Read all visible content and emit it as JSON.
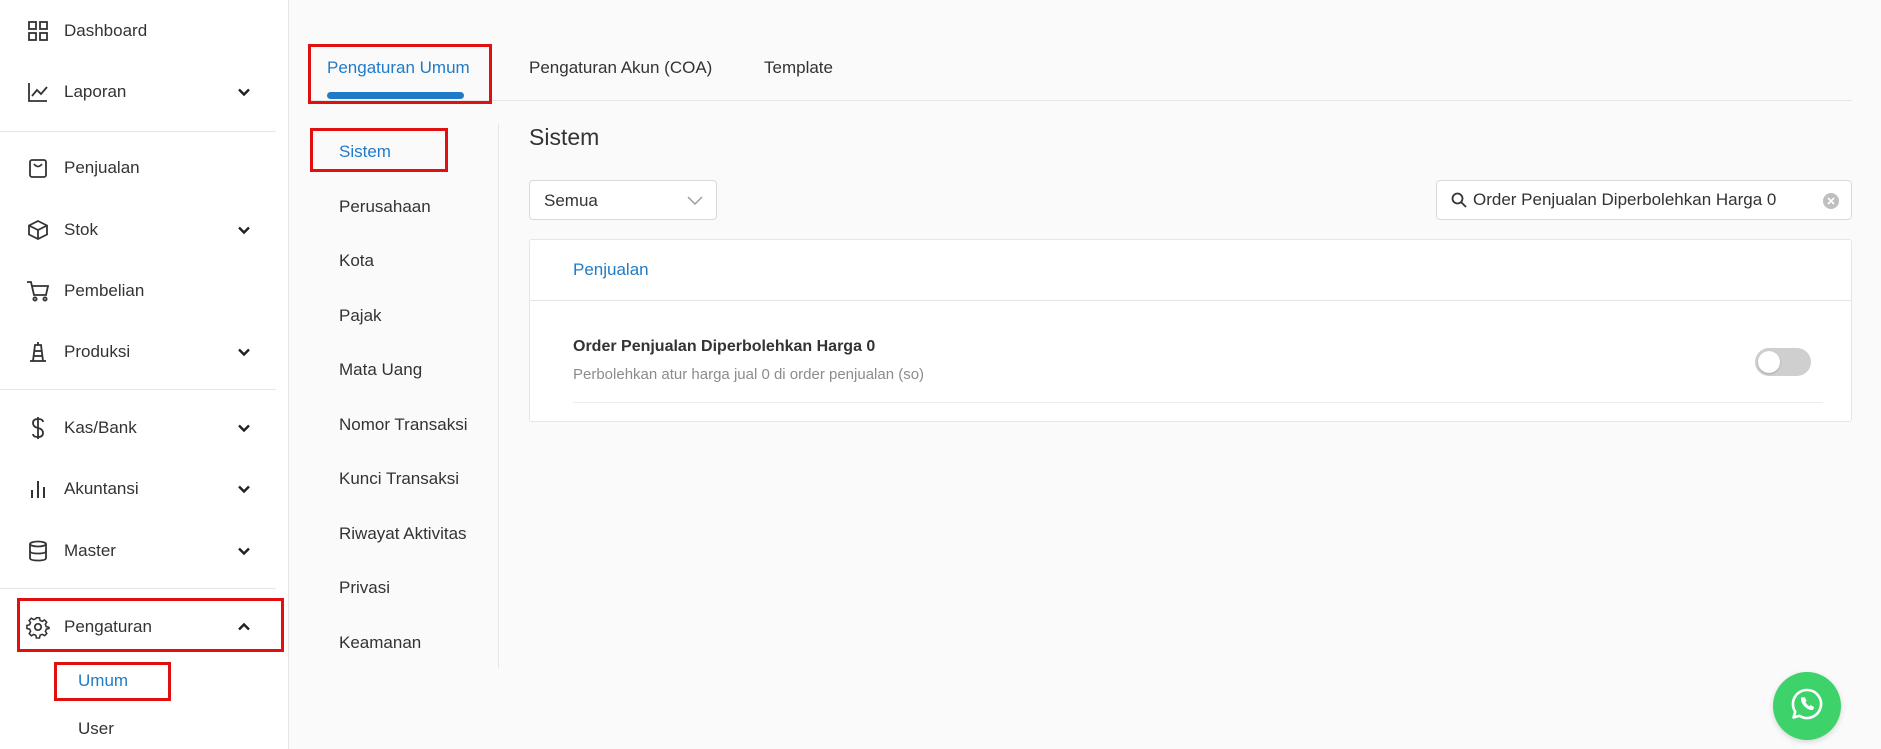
{
  "sidebar": {
    "items": [
      {
        "label": "Dashboard",
        "icon": "grid-icon"
      },
      {
        "label": "Laporan",
        "icon": "line-chart-icon"
      },
      {
        "label": "Penjualan",
        "icon": "shopping-bag-icon"
      },
      {
        "label": "Stok",
        "icon": "box-icon"
      },
      {
        "label": "Pembelian",
        "icon": "cart-icon"
      },
      {
        "label": "Produksi",
        "icon": "factory-icon"
      },
      {
        "label": "Kas/Bank",
        "icon": "dollar-icon"
      },
      {
        "label": "Akuntansi",
        "icon": "bar-chart-icon"
      },
      {
        "label": "Master",
        "icon": "database-icon"
      },
      {
        "label": "Pengaturan",
        "icon": "gear-icon"
      }
    ],
    "sub_items": [
      {
        "label": "Umum"
      },
      {
        "label": "User"
      }
    ]
  },
  "tabs": [
    {
      "label": "Pengaturan Umum"
    },
    {
      "label": "Pengaturan Akun (COA)"
    },
    {
      "label": "Template"
    }
  ],
  "submenu": [
    "Sistem",
    "Perusahaan",
    "Kota",
    "Pajak",
    "Mata Uang",
    "Nomor Transaksi",
    "Kunci Transaksi",
    "Riwayat Aktivitas",
    "Privasi",
    "Keamanan"
  ],
  "main": {
    "title": "Sistem",
    "filter_value": "Semua",
    "search_value": "Order Penjualan Diperbolehkan Harga 0",
    "card_tab": "Penjualan",
    "setting_title": "Order Penjualan Diperbolehkan Harga 0",
    "setting_desc": "Perbolehkan atur harga jual 0 di order penjualan (so)",
    "toggle_on": false
  },
  "colors": {
    "accent": "#1f7bc8",
    "highlight": "#e01010",
    "whatsapp": "#3dd26a"
  }
}
